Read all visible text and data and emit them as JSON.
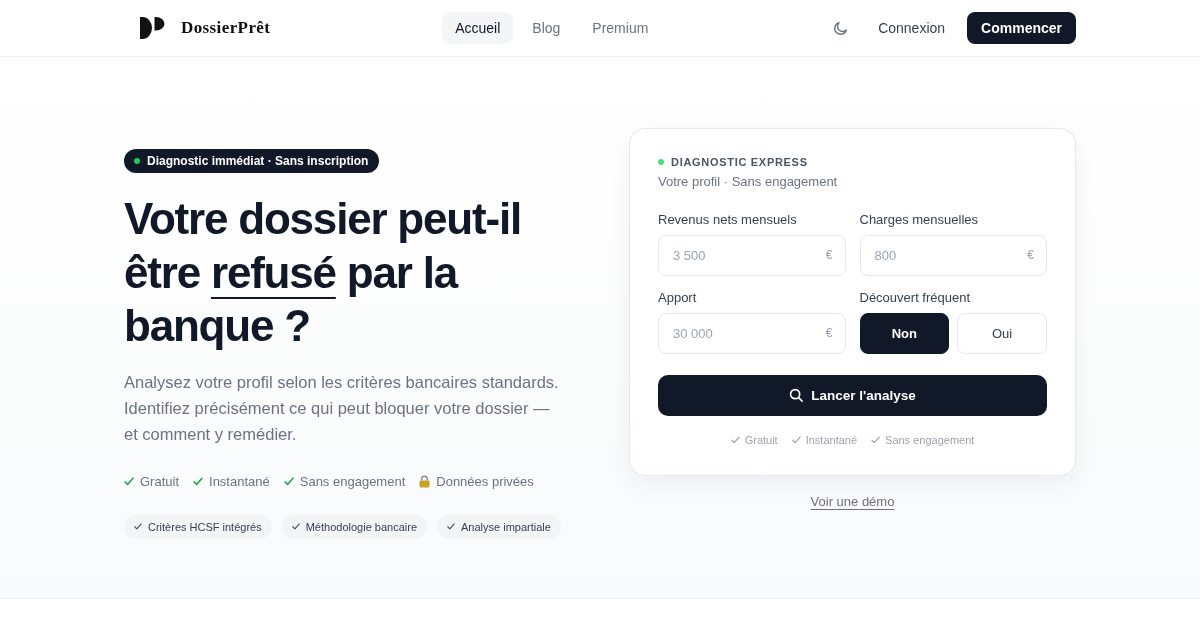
{
  "header": {
    "brand": "DossierPrêt",
    "nav": [
      {
        "label": "Accueil",
        "selected": true
      },
      {
        "label": "Blog",
        "selected": false
      },
      {
        "label": "Premium",
        "selected": false
      }
    ],
    "login": "Connexion",
    "cta": "Commencer"
  },
  "hero": {
    "badge": "Diagnostic immédiat · Sans inscription",
    "title": {
      "lead": "Votre dossier peut-il être",
      "highlight": "refusé",
      "tail": "par la banque ?"
    },
    "description": "Analysez votre profil selon les critères bancaires standards. Identifiez précisément ce qui peut bloquer votre dossier — et comment y remédier.",
    "perks": [
      {
        "kind": "check",
        "label": "Gratuit"
      },
      {
        "kind": "check",
        "label": "Instantané"
      },
      {
        "kind": "check",
        "label": "Sans engagement"
      },
      {
        "kind": "lock",
        "label": "Données privées"
      }
    ],
    "tags": [
      "Critères HCSF intégrés",
      "Méthodologie bancaire",
      "Analyse impartiale"
    ]
  },
  "diagnostic": {
    "eyebrow": "DIAGNOSTIC EXPRESS",
    "subtitle": "Votre profil · Sans engagement",
    "fields": [
      {
        "kind": "amount",
        "label": "Revenus nets mensuels",
        "placeholder": "3 500",
        "unit": "€"
      },
      {
        "kind": "amount",
        "label": "Charges mensuelles",
        "placeholder": "800",
        "unit": "€"
      },
      {
        "kind": "amount",
        "label": "Apport",
        "placeholder": "30 000",
        "unit": "€"
      },
      {
        "kind": "toggle",
        "label": "Découvert fréquent",
        "options": [
          {
            "label": "Non",
            "selected": true
          },
          {
            "label": "Oui",
            "selected": false
          }
        ]
      }
    ],
    "submit": "Lancer l'analyse",
    "perks": [
      "Gratuit",
      "Instantané",
      "Sans engagement"
    ]
  },
  "demo_link": "Voir une démo"
}
